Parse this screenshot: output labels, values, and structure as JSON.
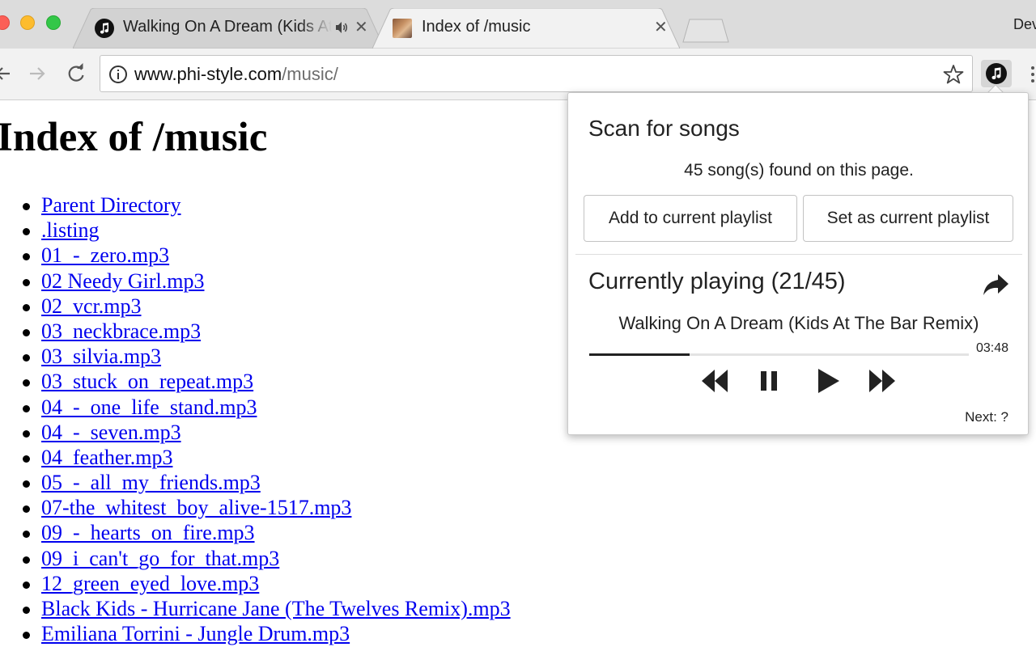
{
  "browser": {
    "tabs": [
      {
        "title": "Walking On A Dream (Kids At The Bar Remix)",
        "active": false,
        "audio_playing": true
      },
      {
        "title": "Index of /music",
        "active": true
      }
    ],
    "profile_label": "Dev",
    "address_bar": {
      "host": "www.phi-style.com",
      "path": "/music/"
    }
  },
  "page": {
    "heading": "Index of /music",
    "links": [
      "Parent Directory",
      ".listing",
      "01_-_zero.mp3",
      "02 Needy Girl.mp3",
      "02_vcr.mp3",
      "03_neckbrace.mp3",
      "03_silvia.mp3",
      "03_stuck_on_repeat.mp3",
      "04_-_one_life_stand.mp3",
      "04_-_seven.mp3",
      "04_feather.mp3",
      "05_-_all_my_friends.mp3",
      "07-the_whitest_boy_alive-1517.mp3",
      "09_-_hearts_on_fire.mp3",
      "09_i_can't_go_for_that.mp3",
      "12_green_eyed_love.mp3",
      "Black Kids - Hurricane Jane (The Twelves Remix).mp3",
      "Emiliana Torrini - Jungle Drum.mp3"
    ]
  },
  "popup": {
    "scan_title": "Scan for songs",
    "found_text": "45 song(s) found on this page.",
    "add_button": "Add to current playlist",
    "set_button": "Set as current playlist",
    "now_playing_title": "Currently playing (21/45)",
    "song_title": "Walking On A Dream (Kids At The Bar Remix)",
    "duration": "03:48",
    "progress_fraction": 0.265,
    "next_label": "Next: ?"
  },
  "colors": {
    "link": "#0000ee",
    "tabstrip": "#dcdcdc",
    "toolbar": "#f2f2f2",
    "traffic_red": "#fc5f57",
    "traffic_yellow": "#fdbc2e",
    "traffic_green": "#33c748"
  },
  "icons": {
    "tab1_favicon": "music-note-icon",
    "tab1_audio": "speaker-icon",
    "tab2_favicon": "photo-thumbnail-icon",
    "extension": "music-note-icon",
    "share": "share-arrow-icon"
  }
}
